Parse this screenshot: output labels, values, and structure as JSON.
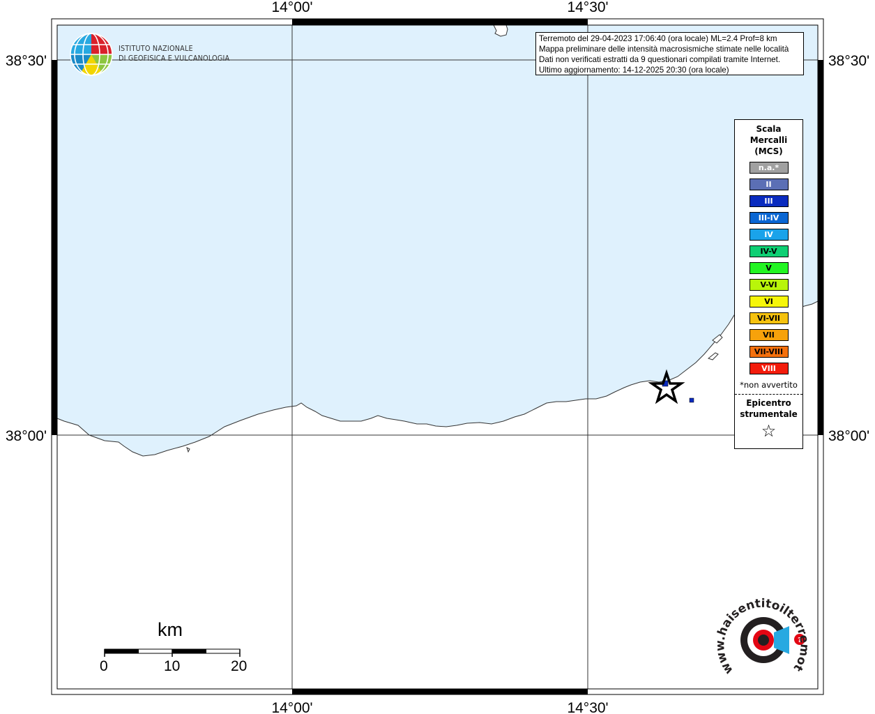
{
  "map": {
    "lon_labels": [
      "14°00'",
      "14°30'"
    ],
    "lat_labels": [
      "38°30'",
      "38°00'"
    ],
    "colors": {
      "sea": "#dff1fd",
      "land": "#ffffff",
      "frame": "#000000",
      "epicenter_marker": "#0a2bbf"
    }
  },
  "logo": {
    "icon": "ingv-globe-icon",
    "line1": "ISTITUTO NAZIONALE",
    "line2": "DI GEOFISICA E VULCANOLOGIA"
  },
  "info": {
    "line1": "Terremoto del 29-04-2023 17:06:40 (ora locale) ML=2.4 Prof=8 km",
    "line2": "Mappa preliminare delle intensità macrosismiche stimate nelle località",
    "line3": "Dati non verificati estratti da 9 questionari compilati tramite Internet.",
    "line4": "Ultimo aggiornamento: 14-12-2025 20:30 (ora locale)"
  },
  "legend": {
    "title_line1": "Scala",
    "title_line2": "Mercalli",
    "title_line3": "(MCS)",
    "items": [
      {
        "label": "n.a.*",
        "color": "#a0a0a0",
        "text_color": "#ffffff"
      },
      {
        "label": "II",
        "color": "#5b6fb5",
        "text_color": "#ffffff"
      },
      {
        "label": "III",
        "color": "#0a2bbf",
        "text_color": "#ffffff"
      },
      {
        "label": "III-IV",
        "color": "#0a66d3",
        "text_color": "#ffffff"
      },
      {
        "label": "IV",
        "color": "#1aa3ea",
        "text_color": "#ffffff"
      },
      {
        "label": "IV-V",
        "color": "#0ecf73",
        "text_color": "#000000"
      },
      {
        "label": "V",
        "color": "#22f522",
        "text_color": "#000000"
      },
      {
        "label": "V-VI",
        "color": "#b9f50a",
        "text_color": "#000000"
      },
      {
        "label": "VI",
        "color": "#f6f60a",
        "text_color": "#000000"
      },
      {
        "label": "VI-VII",
        "color": "#f5c20f",
        "text_color": "#000000"
      },
      {
        "label": "VII",
        "color": "#f7a20b",
        "text_color": "#000000"
      },
      {
        "label": "VII-VIII",
        "color": "#f4700d",
        "text_color": "#000000"
      },
      {
        "label": "VIII",
        "color": "#f31c0c",
        "text_color": "#ffffff"
      }
    ],
    "note": "*non avvertito",
    "epicenter_line1": "Epicentro",
    "epicenter_line2": "strumentale",
    "epicenter_symbol": "☆"
  },
  "scale_bar": {
    "unit": "km",
    "ticks": [
      "0",
      "10",
      "20"
    ]
  },
  "hsit_logo": {
    "icon": "haisentito-logo-icon",
    "text": "www.haisentitoilterremoto.it"
  }
}
